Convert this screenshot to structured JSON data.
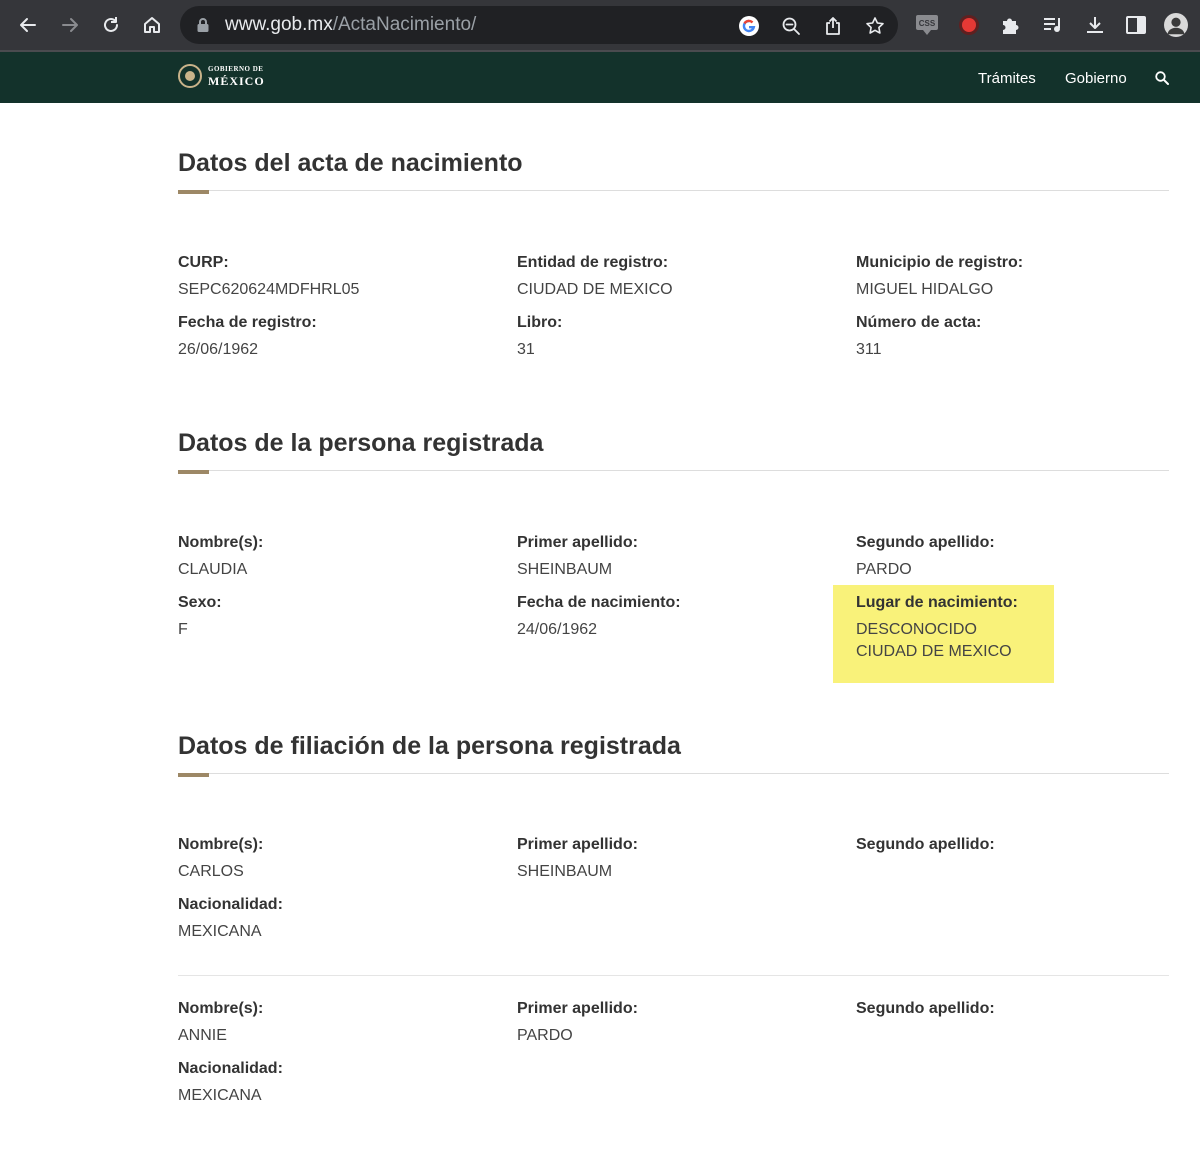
{
  "browser": {
    "url_host": "www.gob.mx",
    "url_path": "/ActaNacimiento/",
    "css_ext_label": "CSS"
  },
  "header": {
    "logo_line1": "GOBIERNO DE",
    "logo_line2": "MÉXICO",
    "nav": [
      "Trámites",
      "Gobierno"
    ]
  },
  "acta": {
    "title": "Datos del acta de nacimiento",
    "curp_label": "CURP:",
    "curp": "SEPC620624MDFHRL05",
    "entidad_label": "Entidad de registro:",
    "entidad": "CIUDAD DE MEXICO",
    "municipio_label": "Municipio de registro:",
    "municipio": "MIGUEL HIDALGO",
    "fecha_label": "Fecha de registro:",
    "fecha": "26/06/1962",
    "libro_label": "Libro:",
    "libro": "31",
    "numero_label": "Número de acta:",
    "numero": "311"
  },
  "persona": {
    "title": "Datos de la persona registrada",
    "nombre_label": "Nombre(s):",
    "nombre": "CLAUDIA",
    "primer_label": "Primer apellido:",
    "primer": "SHEINBAUM",
    "segundo_label": "Segundo apellido:",
    "segundo": "PARDO",
    "sexo_label": "Sexo:",
    "sexo": "F",
    "fecha_nac_label": "Fecha de nacimiento:",
    "fecha_nac": "24/06/1962",
    "lugar_label": "Lugar de nacimiento:",
    "lugar_line1": "DESCONOCIDO",
    "lugar_line2": "CIUDAD DE MEXICO",
    "highlight_color": "#f9f27a"
  },
  "filiacion": {
    "title": "Datos de filiación de la persona registrada",
    "padres": [
      {
        "nombre_label": "Nombre(s):",
        "nombre": "CARLOS",
        "primer_label": "Primer apellido:",
        "primer": "SHEINBAUM",
        "segundo_label": "Segundo apellido:",
        "nacionalidad_label": "Nacionalidad:",
        "nacionalidad": "MEXICANA"
      },
      {
        "nombre_label": "Nombre(s):",
        "nombre": "ANNIE",
        "primer_label": "Primer apellido:",
        "primer": "PARDO",
        "segundo_label": "Segundo apellido:",
        "nacionalidad_label": "Nacionalidad:",
        "nacionalidad": "MEXICANA"
      }
    ]
  },
  "colors": {
    "gov_green": "#13322b",
    "accent_gold": "#9d8866"
  }
}
